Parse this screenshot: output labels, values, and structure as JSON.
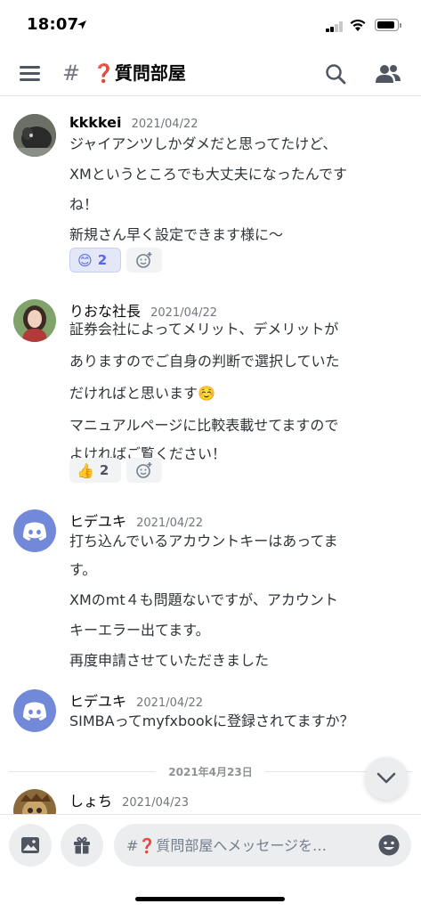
{
  "status_bar": {
    "time": "18:07"
  },
  "header": {
    "hash": "#",
    "channel_name": "❓質問部屋"
  },
  "messages": [
    {
      "author": "kkkkei",
      "timestamp": "2021/04/22",
      "lines": [
        "ジャイアンツしかダメだと思ってたけど、",
        "XMというところでも大丈夫になったんです",
        "ね！",
        "新規さん早く設定できます様に〜"
      ],
      "reaction": {
        "emoji": "😊",
        "count": "2",
        "active": true
      }
    },
    {
      "author": "りおな社長",
      "timestamp": "2021/04/22",
      "lines": [
        "証券会社によってメリット、デメリットが",
        "ありますのでご自身の判断で選択していた",
        "だければと思います☺️",
        "マニュアルページに比較表載せてますので",
        "よければご覧ください！"
      ],
      "reaction": {
        "emoji": "👍",
        "count": "2",
        "active": false
      }
    },
    {
      "author": "ヒデユキ",
      "timestamp": "2021/04/22",
      "lines": [
        "打ち込んでいるアカウントキーはあってま",
        "す。",
        "XMのmt４も問題ないですが、アカウント",
        "キーエラー出てます。",
        "再度申請させていただきました"
      ]
    },
    {
      "author": "ヒデユキ",
      "timestamp": "2021/04/22",
      "lines": [
        "SIMBAってmyfxbookに登録されてますか？"
      ]
    },
    {
      "author": "しょち",
      "timestamp": "2021/04/23",
      "lines": []
    }
  ],
  "date_divider": "2021年4月23日",
  "composer": {
    "placeholder": "#❓質問部屋へメッセージを…"
  },
  "colors": {
    "blurple": "#5865f2",
    "discord_avatar": "#7289da",
    "text": "#2e3338",
    "muted": "#72767d"
  },
  "icons": [
    "location-arrow-icon",
    "signal-icon",
    "wifi-icon",
    "battery-icon",
    "hamburger-icon",
    "search-icon",
    "members-icon",
    "add-reaction-icon",
    "chevron-down-icon",
    "image-icon",
    "gift-icon",
    "emoji-icon"
  ]
}
